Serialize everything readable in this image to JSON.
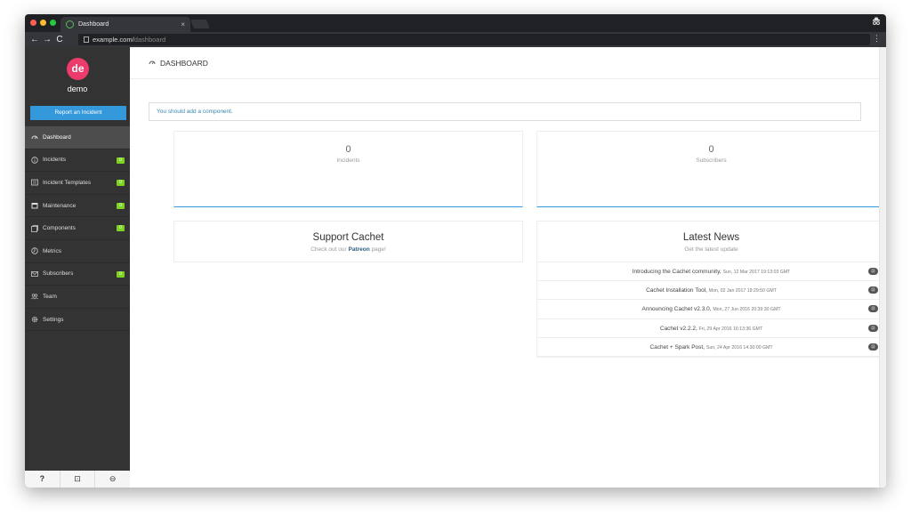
{
  "browser": {
    "tab_title": "Dashboard",
    "tab_close": "×",
    "url_host": "example.com/",
    "url_path": "dashboard",
    "nav_back": "←",
    "nav_forward": "→",
    "nav_reload": "C"
  },
  "sidebar": {
    "avatar_initials": "de",
    "avatar_color": "#ed3b6b",
    "username": "demo",
    "report_button": "Report an Incident",
    "items": [
      {
        "label": "Dashboard",
        "icon": "dashboard-gauge-icon",
        "badge": ""
      },
      {
        "label": "Incidents",
        "icon": "info-circle-icon",
        "badge": "0"
      },
      {
        "label": "Incident Templates",
        "icon": "template-icon",
        "badge": "0"
      },
      {
        "label": "Maintenance",
        "icon": "calendar-icon",
        "badge": "0"
      },
      {
        "label": "Components",
        "icon": "components-icon",
        "badge": "0"
      },
      {
        "label": "Metrics",
        "icon": "metrics-icon",
        "badge": ""
      },
      {
        "label": "Subscribers",
        "icon": "mail-icon",
        "badge": "0"
      },
      {
        "label": "Team",
        "icon": "team-icon",
        "badge": ""
      },
      {
        "label": "Settings",
        "icon": "gear-icon",
        "badge": ""
      }
    ],
    "footer": {
      "help": "?",
      "status_page": "⊡",
      "logout": "⊖"
    }
  },
  "header": {
    "title": "DASHBOARD"
  },
  "alert": {
    "text": "You should add a component."
  },
  "stats": [
    {
      "value": "0",
      "label": "Incidents"
    },
    {
      "value": "0",
      "label": "Subscribers"
    }
  ],
  "support": {
    "title": "Support Cachet",
    "sub_before": "Check out our",
    "sub_link": "Patreon",
    "sub_after": "page!"
  },
  "news": {
    "title": "Latest News",
    "subtitle": "Get the latest update",
    "items": [
      {
        "title": "Introducing the Cachet community,",
        "date": "Sun, 12 Mar 2017 19:13:03 GMT"
      },
      {
        "title": "Cachet Installation Tool,",
        "date": "Mon, 02 Jan 2017 19:29:50 GMT"
      },
      {
        "title": "Announcing Cachet v2.3.0,",
        "date": "Mon, 27 Jun 2016 20:39:30 GMT"
      },
      {
        "title": "Cachet v2.2.2,",
        "date": "Fri, 29 Apr 2016 16:13:36 GMT"
      },
      {
        "title": "Cachet + Spark Post,",
        "date": "Sun, 24 Apr 2016 14:30:00 GMT"
      }
    ]
  },
  "colors": {
    "accent": "#3498db",
    "badge_green": "#7ed321",
    "sidebar_bg": "#333333"
  }
}
